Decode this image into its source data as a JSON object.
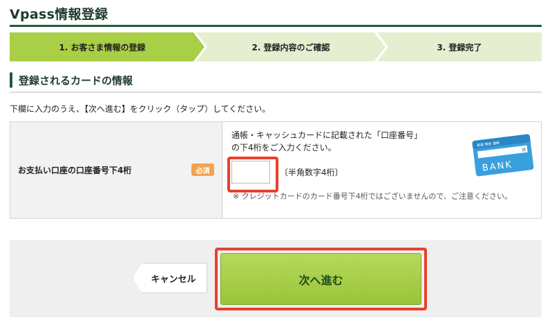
{
  "header": {
    "title": "Vpass情報登録"
  },
  "steps": [
    {
      "label": "1. お客さま情報の登録",
      "active": true
    },
    {
      "label": "2. 登録内容のご確認",
      "active": false
    },
    {
      "label": "3. 登録完了",
      "active": false
    }
  ],
  "section": {
    "title": "登録されるカードの情報"
  },
  "instruction": "下欄に入力のうえ、【次へ進む】をクリック（タップ）してください。",
  "form": {
    "field_label": "お支払い口座の口座番号下4桁",
    "required_label": "必須",
    "hint_line1": "通帳・キャッシュカードに記載された「口座番号」",
    "hint_line2": "の下4桁をご入力ください。",
    "input_value": "",
    "input_note": "〔半角数字4桁〕",
    "caution": "※ クレジットカードのカード番号下4桁ではございませんので、ご注意ください。",
    "card_image": {
      "top_text": "普通 預金 通帳",
      "small_text": "様",
      "bank_text": "BANK"
    }
  },
  "actions": {
    "cancel_label": "キャンセル",
    "next_label": "次へ進む"
  },
  "colors": {
    "brand_green": "#1d5a3a",
    "active_step": "#a8cf45",
    "inactive_step": "#e3efcf",
    "highlight_red": "#e8402a",
    "required_orange": "#f3a34b"
  }
}
